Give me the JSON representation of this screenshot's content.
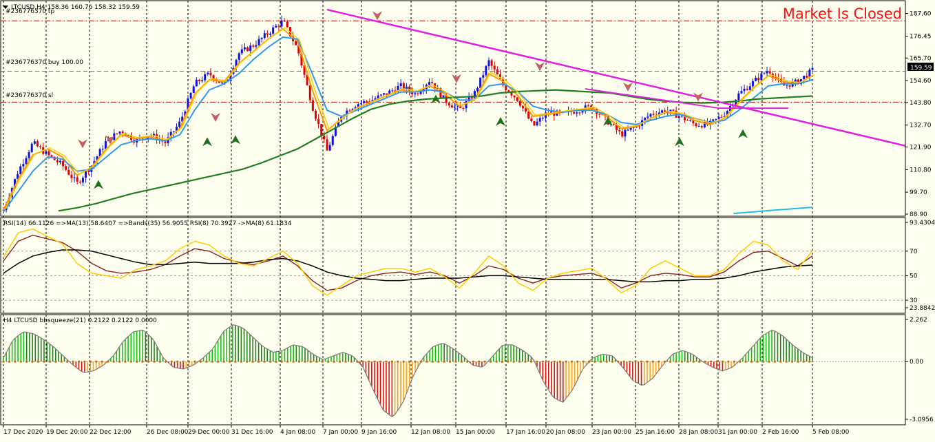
{
  "main": {
    "header": "LTCUSD,H4  158.36 160.76 158.32 159.59",
    "market_status": "Market Is Closed",
    "trade_lines": {
      "tp": {
        "label": "#236776370 tp",
        "price": 184.0
      },
      "buy": {
        "label": "#236776370 buy 100.00",
        "price": 159.2
      },
      "sl": {
        "label": "#236776370 sl",
        "price": 144.0
      }
    },
    "current_price_tag": "159.59",
    "y_ticks": [
      "187.60",
      "176.45",
      "165.70",
      "154.60",
      "143.80",
      "132.70",
      "121.90",
      "110.80",
      "99.70",
      "88.90"
    ],
    "colors": {
      "bull": "#1010E0",
      "bear": "#E00000",
      "trend": "#E020E0",
      "ma_slow": "#208020",
      "ma_mid": "#FF9900",
      "ma_fast": "#3399EE",
      "tp_sl": "#C00000",
      "entry": "#40A040"
    }
  },
  "rsi": {
    "header": "RSI(14) 66.1126  =>MA(13) 58.6407  =>Bands(35) 56.9055  RSI(8) 70.3927  ->MA(8) 61.1834",
    "y_ticks": [
      "93.4304",
      "70",
      "50",
      "30",
      "23.8842"
    ]
  },
  "squeeze": {
    "header": "H4 LTCUSD bbsqueeze(21) 0.2122 0.2122 0.0000",
    "y_ticks": [
      "2.262",
      "0.00",
      "-3.0956"
    ]
  },
  "x_ticks": [
    "17 Dec 2020",
    "19 Dec 20:00",
    "22 Dec 12:00",
    "26 Dec 08:00",
    "29 Dec 00:00",
    "31 Dec 16:00",
    "4 Jan 08:00",
    "7 Jan 00:00",
    "9 Jan 16:00",
    "12 Jan 08:00",
    "15 Jan 00:00",
    "17 Jan 16:00",
    "20 Jan 08:00",
    "23 Jan 00:00",
    "25 Jan 16:00",
    "28 Jan 08:00",
    "31 Jan 00:00",
    "2 Feb 16:00",
    "5 Feb 08:00"
  ],
  "chart_data": [
    {
      "type": "candlestick",
      "title": "LTCUSD,H4",
      "ylim": [
        88.9,
        189.5
      ],
      "x": [
        "17 Dec 2020",
        "19 Dec 20:00",
        "22 Dec 12:00",
        "26 Dec 08:00",
        "29 Dec 00:00",
        "31 Dec 16:00",
        "4 Jan 08:00",
        "7 Jan 00:00",
        "9 Jan 16:00",
        "12 Jan 08:00",
        "15 Jan 00:00",
        "17 Jan 16:00",
        "20 Jan 08:00",
        "23 Jan 00:00",
        "25 Jan 16:00",
        "28 Jan 08:00",
        "31 Jan 00:00",
        "2 Feb 16:00",
        "5 Feb 08:00"
      ],
      "close_path": [
        91,
        110,
        124,
        118,
        113,
        104,
        113,
        125,
        130,
        125,
        128,
        124,
        134,
        153,
        158,
        152,
        168,
        172,
        178,
        184,
        170,
        142,
        120,
        138,
        143,
        145,
        148,
        152,
        148,
        155,
        145,
        140,
        148,
        164,
        152,
        145,
        132,
        139,
        138,
        140,
        142,
        135,
        128,
        132,
        138,
        140,
        137,
        133,
        133,
        138,
        148,
        154,
        160,
        152,
        154,
        159.59
      ],
      "series": [
        {
          "name": "",
          "values": [
            91,
            106,
            118,
            121,
            117,
            108,
            112,
            121,
            128,
            126,
            127,
            125,
            131,
            148,
            155,
            154,
            163,
            169,
            175,
            180,
            174,
            150,
            130,
            136,
            141,
            144,
            147,
            150,
            149,
            152,
            148,
            142,
            145,
            158,
            154,
            147,
            137,
            138,
            139,
            140,
            141,
            137,
            131,
            132,
            136,
            139,
            138,
            135,
            133,
            136,
            144,
            151,
            157,
            154,
            153,
            157
          ]
        },
        {
          "name": "",
          "values": [
            90,
            100,
            110,
            117,
            116,
            110,
            111,
            117,
            123,
            125,
            126,
            125,
            128,
            140,
            150,
            153,
            158,
            165,
            171,
            176,
            175,
            158,
            140,
            137,
            140,
            143,
            146,
            149,
            149,
            150,
            149,
            145,
            145,
            152,
            153,
            149,
            142,
            140,
            139,
            140,
            140,
            138,
            134,
            133,
            135,
            137,
            138,
            136,
            134,
            135,
            140,
            146,
            152,
            153,
            153,
            155
          ]
        },
        {
          "name": "",
          "values": [
            90.5,
            92,
            94,
            96.5,
            99,
            101,
            103,
            105,
            107,
            109,
            111,
            114,
            117.5,
            121,
            126,
            131,
            136,
            140.5,
            143,
            144.5,
            145.5,
            146,
            146.5,
            147,
            148.5,
            149.2,
            149.6,
            150,
            149.5,
            149,
            148.5,
            147,
            145.5,
            144.5,
            143.8,
            143.6,
            143.8,
            144.5,
            145.5,
            146,
            146.5,
            147
          ]
        },
        {
          "name": "",
          "values": [
            null,
            null,
            null,
            null,
            null,
            null,
            null,
            null,
            null,
            null,
            null,
            null,
            null,
            null,
            null,
            null,
            null,
            null,
            null,
            null,
            null,
            null,
            null,
            null,
            null,
            null,
            null,
            null,
            null,
            null,
            null,
            null,
            null,
            null,
            null,
            null,
            null,
            89.2,
            90.0,
            90.8,
            91.5,
            92.3
          ]
        }
      ],
      "trendline": [
        {
          "date": "9 Jan 00:00",
          "price": 189.5
        },
        {
          "date": "8 Feb",
          "price": 122.5
        }
      ]
    },
    {
      "type": "line",
      "title": "RSI(14)",
      "ylim": [
        23.8842,
        93.4304
      ],
      "series": [
        {
          "name": "RSI(14)",
          "values": [
            62,
            78,
            83,
            80,
            77,
            70,
            60,
            54,
            52,
            53,
            55,
            59,
            66,
            72,
            70,
            64,
            61,
            59,
            62,
            66,
            58,
            46,
            38,
            40,
            46,
            50,
            52,
            53,
            51,
            53,
            50,
            44,
            50,
            58,
            55,
            48,
            44,
            48,
            50,
            51,
            52,
            48,
            40,
            44,
            50,
            52,
            51,
            49,
            49,
            53,
            62,
            69,
            70,
            64,
            58,
            66.1126
          ]
        },
        {
          "name": "MA(13)",
          "values": [
            52,
            60,
            66,
            69,
            71,
            71,
            70,
            67,
            64,
            61,
            59,
            59,
            60,
            61,
            60,
            60,
            60,
            61,
            63,
            64,
            62,
            58,
            53,
            50,
            48,
            47,
            46,
            46,
            47,
            48,
            48,
            48,
            49,
            50,
            50,
            49,
            48,
            47,
            47,
            47,
            47,
            47,
            46,
            45,
            45,
            46,
            46,
            47,
            47,
            48,
            50,
            53,
            55,
            57,
            58,
            58.6407
          ]
        },
        {
          "name": "RSI(8)",
          "values": [
            65,
            85,
            88,
            82,
            76,
            60,
            52,
            50,
            48,
            55,
            58,
            62,
            72,
            78,
            75,
            66,
            60,
            58,
            64,
            70,
            60,
            42,
            34,
            42,
            50,
            53,
            56,
            56,
            53,
            56,
            49,
            40,
            52,
            66,
            58,
            44,
            38,
            48,
            52,
            54,
            56,
            47,
            36,
            42,
            56,
            62,
            56,
            50,
            50,
            55,
            68,
            78,
            75,
            62,
            55,
            70.3927
          ]
        }
      ]
    },
    {
      "type": "bar",
      "title": "bbsqueeze(21)",
      "ylim": [
        -3.0956,
        2.262
      ],
      "values": [
        0.2,
        1.2,
        1.6,
        1.5,
        1.2,
        0.8,
        0.3,
        -0.2,
        -0.6,
        -0.5,
        -0.2,
        0.3,
        1.1,
        1.6,
        1.7,
        1.2,
        0.2,
        -0.3,
        -0.4,
        -0.2,
        0.2,
        0.7,
        1.6,
        2.0,
        1.8,
        1.3,
        0.8,
        0.5,
        0.6,
        0.9,
        0.8,
        0.4,
        0.1,
        0.3,
        0.5,
        0.3,
        -0.3,
        -1.5,
        -2.6,
        -3.0,
        -2.2,
        -0.8,
        0.2,
        0.8,
        1.0,
        0.7,
        0.3,
        -0.2,
        -0.3,
        0.3,
        0.9,
        0.9,
        0.6,
        0.2,
        -1.0,
        -1.9,
        -2.2,
        -1.5,
        -0.4,
        0.2,
        0.4,
        0.3,
        -0.3,
        -1.0,
        -1.3,
        -0.9,
        -0.2,
        0.4,
        0.6,
        0.4,
        0.0,
        -0.3,
        -0.5,
        -0.3,
        0.2,
        0.8,
        1.4,
        1.7,
        1.4,
        0.9,
        0.5,
        0.2
      ]
    }
  ]
}
